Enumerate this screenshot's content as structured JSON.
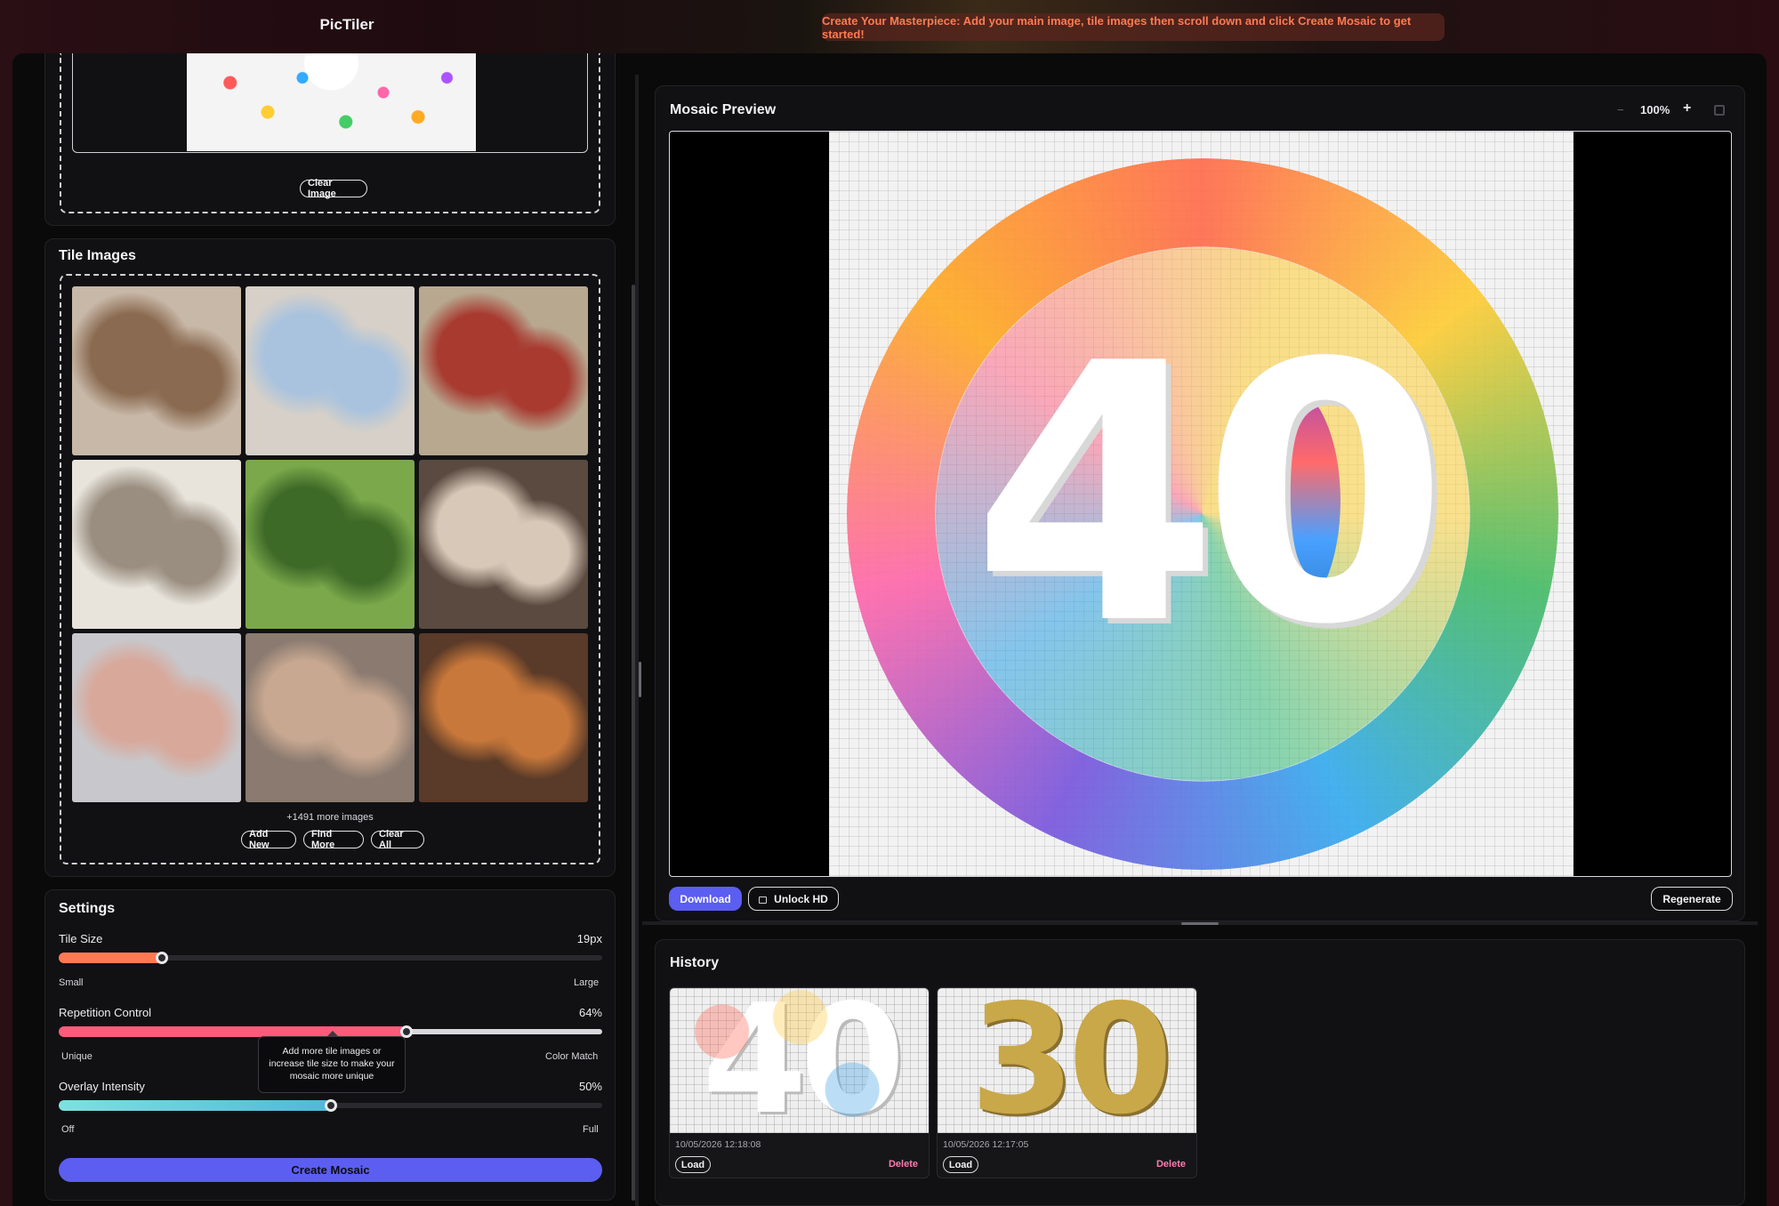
{
  "app": {
    "brand": "PicTiler",
    "banner": "Create Your Masterpiece: Add your main image, tile images then scroll down and click Create Mosaic to get started!"
  },
  "main_image": {
    "clear_label": "Clear Image"
  },
  "tiles": {
    "title": "Tile Images",
    "more_text": "+1491 more images",
    "buttons": {
      "add": "Add New",
      "find": "Find More",
      "clear": "Clear All"
    },
    "images": [
      {
        "name": "family-playing-photo",
        "colors": [
          "#c8b8a8",
          "#8a6a50"
        ]
      },
      {
        "name": "grandparents-photo",
        "colors": [
          "#d6d0c8",
          "#a9c3de"
        ]
      },
      {
        "name": "kids-party-photo",
        "colors": [
          "#b8a890",
          "#a83a30"
        ]
      },
      {
        "name": "father-daughter-photo",
        "colors": [
          "#e8e4dc",
          "#9a8e80"
        ]
      },
      {
        "name": "kids-in-park-photo",
        "colors": [
          "#7aa84a",
          "#3e6a28"
        ]
      },
      {
        "name": "mother-child-photo",
        "colors": [
          "#5a4a40",
          "#d8c8b8"
        ]
      },
      {
        "name": "baby-hands-photo",
        "colors": [
          "#c8c8cc",
          "#d8a89a"
        ]
      },
      {
        "name": "father-newborn-photo",
        "colors": [
          "#8a7a70",
          "#c8a890"
        ]
      },
      {
        "name": "older-couple-photo",
        "colors": [
          "#5a3a28",
          "#c8783a"
        ]
      }
    ]
  },
  "settings": {
    "title": "Settings",
    "tile_size": {
      "label": "Tile Size",
      "value": "19px",
      "min_label": "Small",
      "max_label": "Large",
      "level": 0.19
    },
    "repetition": {
      "label": "Repetition Control",
      "value": "64%",
      "min_label": "Unique",
      "max_label": "Color Match",
      "level": 0.64
    },
    "overlay": {
      "label": "Overlay Intensity",
      "value": "50%",
      "min_label": "Off",
      "max_label": "Full",
      "level": 0.5
    },
    "tooltip": "Add more tile images or increase tile size to make your mosaic more unique",
    "create_label": "Create Mosaic"
  },
  "preview": {
    "title": "Mosaic Preview",
    "zoom": "100%",
    "zoom_out": "−",
    "zoom_in": "+",
    "mosaic_text": "40",
    "download": "Download",
    "unlock": "Unlock HD",
    "regenerate": "Regenerate"
  },
  "history": {
    "title": "History",
    "items": [
      {
        "date": "10/05/2026 12:18:08",
        "load": "Load",
        "delete": "Delete",
        "thumb_text": "40"
      },
      {
        "date": "10/05/2026 12:17:05",
        "load": "Load",
        "delete": "Delete",
        "thumb_text": "30"
      }
    ]
  },
  "colors": {
    "accent": "#5b5ef0",
    "banner_text": "#ff7a52",
    "tile_size_fill": "#ff7a52",
    "repetition_fill": "#ff5a7a",
    "overlay_fill": "#6fd6e0",
    "delete_text": "#ff7ab0"
  }
}
